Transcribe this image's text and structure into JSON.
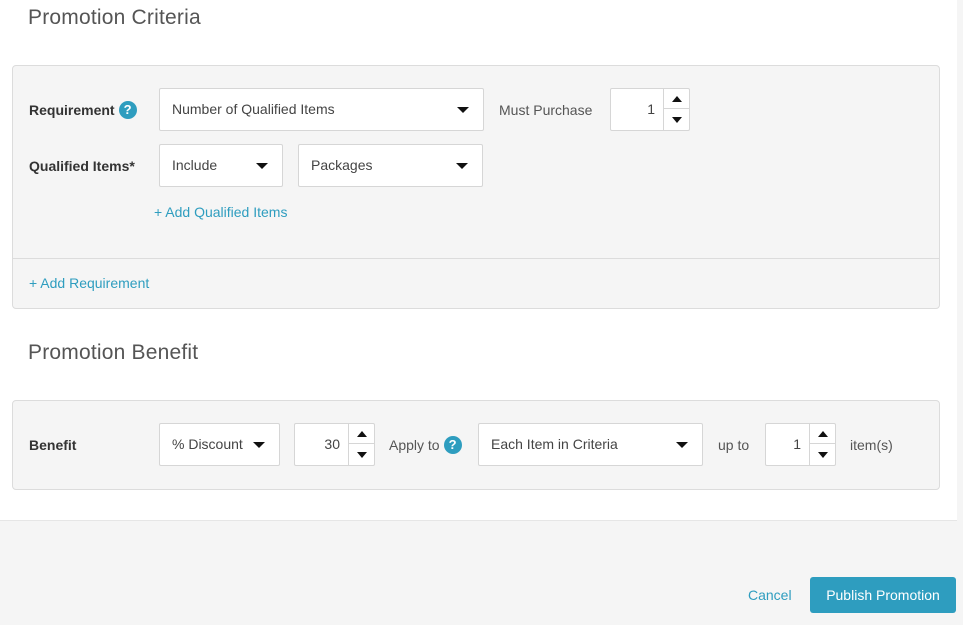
{
  "criteria": {
    "title": "Promotion Criteria",
    "requirement_label": "Requirement",
    "requirement_help": "?",
    "requirement_select": "Number of Qualified Items",
    "must_purchase_label": "Must Purchase",
    "must_purchase_value": "1",
    "qualified_items_label": "Qualified Items*",
    "include_select": "Include",
    "packages_select": "Packages",
    "add_qualified_items": "+ Add Qualified Items",
    "add_requirement": "+ Add Requirement"
  },
  "benefit": {
    "title": "Promotion Benefit",
    "benefit_label": "Benefit",
    "discount_select": "% Discount",
    "discount_value": "30",
    "apply_to_label": "Apply to",
    "apply_to_help": "?",
    "apply_to_select": "Each Item in Criteria",
    "up_to_label": "up to",
    "up_to_value": "1",
    "items_unit": "item(s)"
  },
  "footer": {
    "cancel_label": "Cancel",
    "publish_label": "Publish Promotion"
  },
  "icons": {
    "help": "question-circle-icon",
    "dropdown": "caret-down-icon",
    "increment": "caret-up-icon",
    "decrement": "caret-down-icon"
  },
  "colors": {
    "accent": "#2e9dbf",
    "panel_bg": "#f5f5f5",
    "page_bg": "#f5f5f5",
    "card_bg": "#ffffff"
  }
}
